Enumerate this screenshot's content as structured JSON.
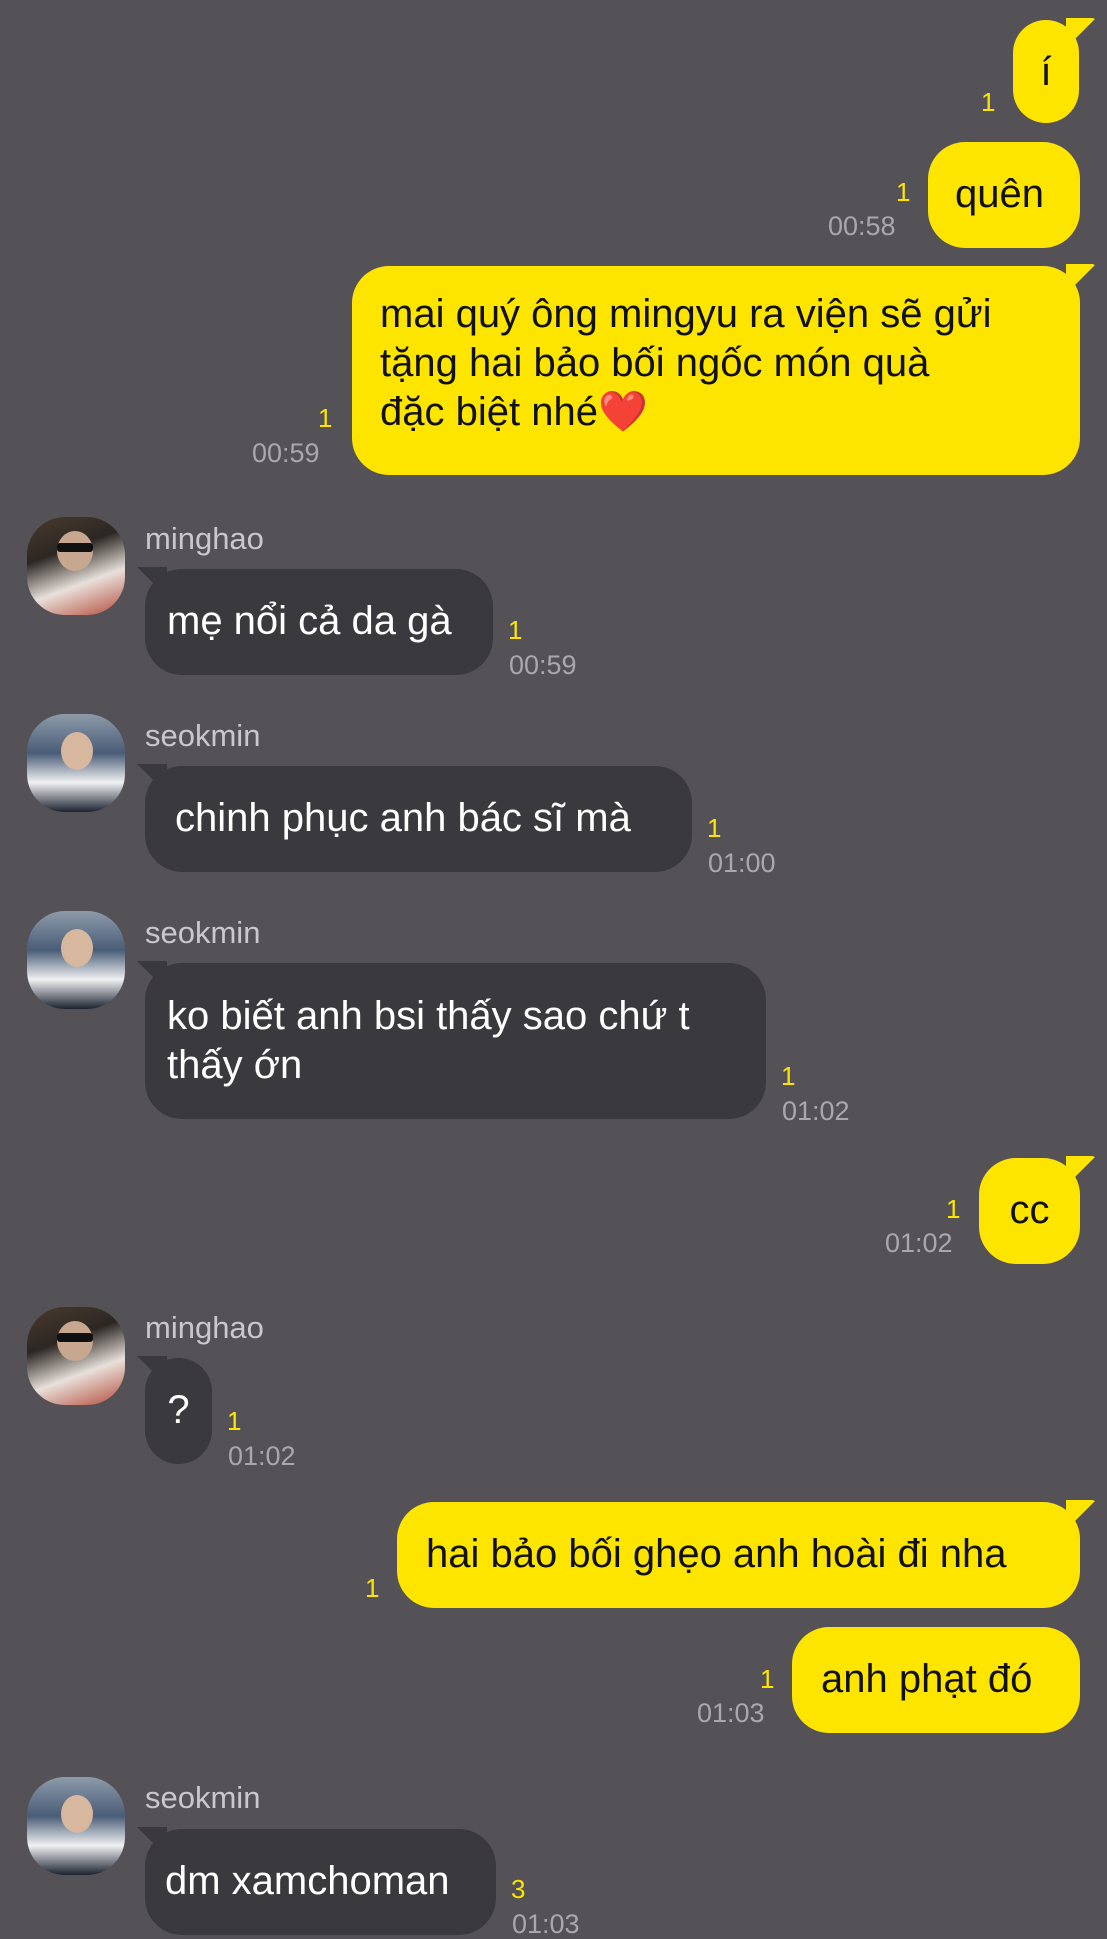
{
  "messages": [
    {
      "sender": "me",
      "text": "í",
      "unread": "1",
      "time": ""
    },
    {
      "sender": "me",
      "text": "quên",
      "unread": "1",
      "time": "00:58"
    },
    {
      "sender": "me",
      "lines": [
        "mai quý ông mingyu ra viện sẽ gửi",
        "tặng hai bảo bối ngốc món quà",
        "đặc biệt nhé"
      ],
      "emoji": "❤️",
      "unread": "1",
      "time": "00:59"
    },
    {
      "sender": "minghao",
      "name": "minghao",
      "text": "mẹ nổi cả da gà",
      "unread": "1",
      "time": "00:59"
    },
    {
      "sender": "seokmin",
      "name": "seokmin",
      "text": "chinh phục anh bác sĩ mà",
      "unread": "1",
      "time": "01:00"
    },
    {
      "sender": "seokmin",
      "name": "seokmin",
      "lines": [
        "ko biết anh bsi thấy sao chứ t",
        "thấy ớn"
      ],
      "unread": "1",
      "time": "01:02"
    },
    {
      "sender": "me",
      "text": "cc",
      "unread": "1",
      "time": "01:02"
    },
    {
      "sender": "minghao",
      "name": "minghao",
      "text": "?",
      "unread": "1",
      "time": "01:02"
    },
    {
      "sender": "me",
      "text": "hai bảo bối ghẹo anh hoài đi nha",
      "unread": "1",
      "time": ""
    },
    {
      "sender": "me",
      "text": "anh phạt đó",
      "unread": "1",
      "time": "01:03"
    },
    {
      "sender": "seokmin",
      "name": "seokmin",
      "text": "dm xamchoman",
      "unread": "3",
      "time": "01:03"
    }
  ],
  "colors": {
    "background": "#545257",
    "outgoing": "#FEE500",
    "incoming": "#3A393D",
    "unread": "#FEE500"
  }
}
